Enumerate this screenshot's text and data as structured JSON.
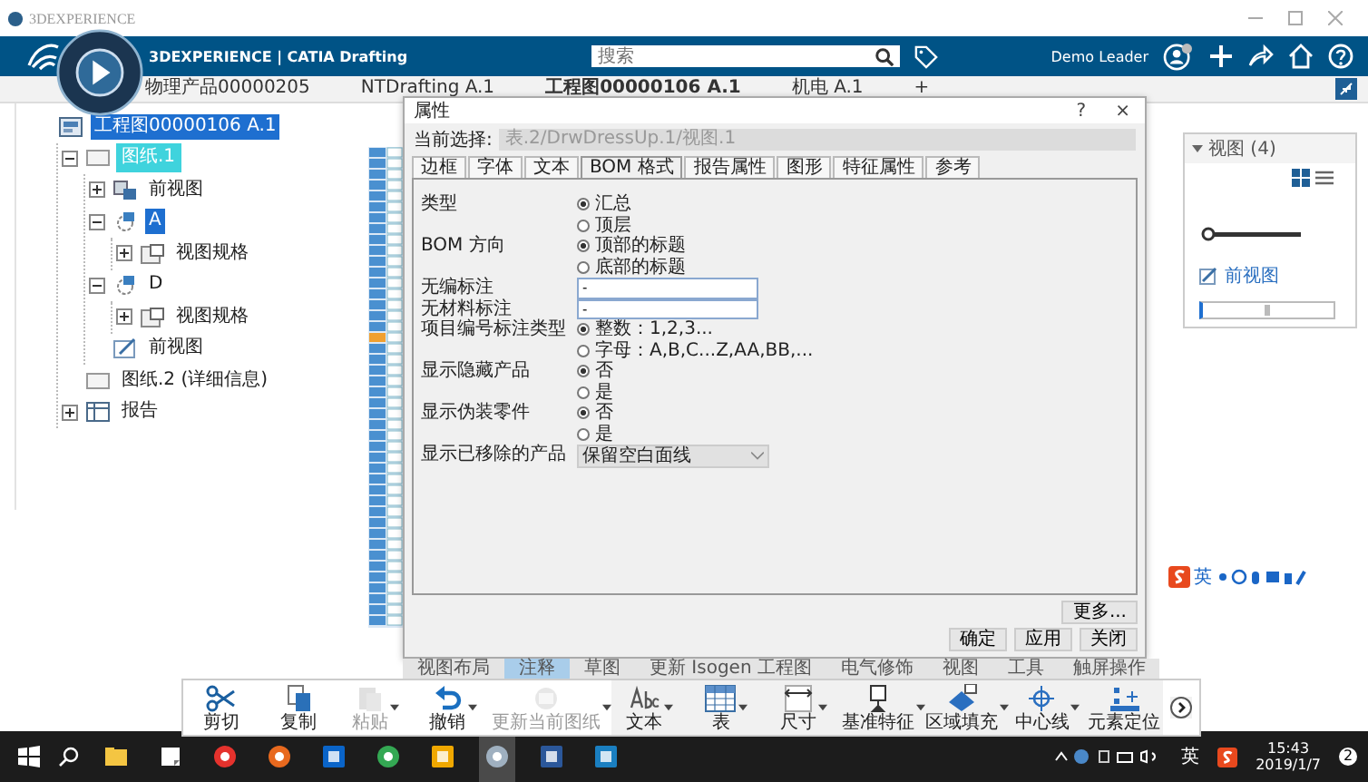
{
  "window": {
    "title": "3DEXPERIENCE"
  },
  "header": {
    "brand": "3DEXPERIENCE | CATIA Drafting",
    "search": {
      "placeholder": "搜索"
    },
    "user": "Demo Leader"
  },
  "doc_tabs": [
    {
      "label": "物理产品00000205",
      "selected": false
    },
    {
      "label": "NTDrafting A.1",
      "selected": false
    },
    {
      "label": "工程图00000106 A.1",
      "selected": true
    },
    {
      "label": "机电 A.1",
      "selected": false
    },
    {
      "label": "+",
      "selected": false
    }
  ],
  "tree": [
    {
      "label": "工程图00000106 A.1",
      "kind": "drawing",
      "selected": true,
      "active": false,
      "children": [
        {
          "label": "图纸.1",
          "kind": "sheet",
          "selected": false,
          "active": true,
          "expanded": true,
          "children": [
            {
              "label": "前视图",
              "kind": "view",
              "selected": false,
              "active": false,
              "expanded": false
            },
            {
              "label": "A",
              "kind": "callout",
              "selected": true,
              "active": false,
              "expanded": true,
              "children": [
                {
                  "label": "视图规格",
                  "kind": "spec",
                  "selected": false,
                  "active": false,
                  "expanded": false
                }
              ]
            },
            {
              "label": "D",
              "kind": "callout",
              "selected": false,
              "active": false,
              "expanded": true,
              "children": [
                {
                  "label": "视图规格",
                  "kind": "spec",
                  "selected": false,
                  "active": false,
                  "expanded": false
                }
              ]
            },
            {
              "label": "前视图",
              "kind": "sketch",
              "selected": false,
              "active": false
            }
          ]
        },
        {
          "label": "图纸.2 (详细信息)",
          "kind": "detail",
          "selected": false,
          "active": false
        },
        {
          "label": "报告",
          "kind": "report",
          "selected": false,
          "active": false,
          "expanded": false
        }
      ]
    }
  ],
  "dialog": {
    "title": "属性",
    "help": "?",
    "close": "×",
    "selection_label": "当前选择:",
    "selection_value": "表.2/DrwDressUp.1/视图.1",
    "tabs": [
      {
        "label": "边框",
        "selected": false
      },
      {
        "label": "字体",
        "selected": false
      },
      {
        "label": "文本",
        "selected": false
      },
      {
        "label": "BOM 格式",
        "selected": true
      },
      {
        "label": "报告属性",
        "selected": false
      },
      {
        "label": "图形",
        "selected": false
      },
      {
        "label": "特征属性",
        "selected": false
      },
      {
        "label": "参考",
        "selected": false
      }
    ],
    "rows": [
      {
        "kind": "radio",
        "label": "类型",
        "options": [
          {
            "label": "汇总",
            "checked": true
          },
          {
            "label": "顶层",
            "checked": false
          }
        ]
      },
      {
        "kind": "radio",
        "label": "BOM 方向",
        "options": [
          {
            "label": "顶部的标题",
            "checked": true
          },
          {
            "label": "底部的标题",
            "checked": false
          }
        ]
      },
      {
        "kind": "field",
        "label": "无编标注",
        "value": "-"
      },
      {
        "kind": "field",
        "label": "无材料标注",
        "value": "-"
      },
      {
        "kind": "radio",
        "label": "项目编号标注类型",
        "options": [
          {
            "label": "整数：1,2,3...",
            "checked": true
          },
          {
            "label": "字母：A,B,C...Z,AA,BB,...",
            "checked": false
          }
        ]
      },
      {
        "kind": "radio",
        "label": "显示隐藏产品",
        "options": [
          {
            "label": "否",
            "checked": true
          },
          {
            "label": "是",
            "checked": false
          }
        ]
      },
      {
        "kind": "radio",
        "label": "显示伪装零件",
        "options": [
          {
            "label": "否",
            "checked": true
          },
          {
            "label": "是",
            "checked": false
          }
        ]
      },
      {
        "kind": "select",
        "label": "显示已移除的产品",
        "value": "保留空白面线"
      }
    ],
    "buttons": {
      "more": "更多...",
      "ok": "确定",
      "apply": "应用",
      "close": "关闭"
    }
  },
  "views_panel": {
    "title": "视图 (4)",
    "link": "前视图"
  },
  "ime_bar": {
    "mode": "英"
  },
  "ribbon_tabs": [
    {
      "label": "视图布局",
      "selected": false
    },
    {
      "label": "注释",
      "selected": true
    },
    {
      "label": "草图",
      "selected": false
    },
    {
      "label": "更新 Isogen 工程图",
      "selected": false
    },
    {
      "label": "电气修饰",
      "selected": false
    },
    {
      "label": "视图",
      "selected": false
    },
    {
      "label": "工具",
      "selected": false
    },
    {
      "label": "触屏操作",
      "selected": false
    }
  ],
  "toolbar": [
    {
      "label": "剪切",
      "kind": "cut",
      "disabled": false,
      "dropdown": false
    },
    {
      "label": "复制",
      "kind": "copy",
      "disabled": false,
      "dropdown": false
    },
    {
      "label": "粘贴",
      "kind": "paste",
      "disabled": true,
      "dropdown": true
    },
    {
      "label": "撤销",
      "kind": "undo",
      "disabled": false,
      "dropdown": true
    },
    {
      "label": "更新当前图纸",
      "kind": "update",
      "disabled": true,
      "dropdown": true
    },
    {
      "label": "文本",
      "kind": "text",
      "disabled": false,
      "dropdown": true
    },
    {
      "label": "表",
      "kind": "table",
      "disabled": false,
      "dropdown": true
    },
    {
      "label": "尺寸",
      "kind": "dimension",
      "disabled": false,
      "dropdown": true
    },
    {
      "label": "基准特征",
      "kind": "datum",
      "disabled": false,
      "dropdown": true
    },
    {
      "label": "区域填充",
      "kind": "fill",
      "disabled": false,
      "dropdown": true
    },
    {
      "label": "中心线",
      "kind": "centerline",
      "disabled": false,
      "dropdown": true
    },
    {
      "label": "元素定位",
      "kind": "position",
      "disabled": false,
      "dropdown": false
    }
  ],
  "taskbar": {
    "ime": "英",
    "time": "15:43",
    "date": "2019/1/7",
    "notifications": "2"
  }
}
